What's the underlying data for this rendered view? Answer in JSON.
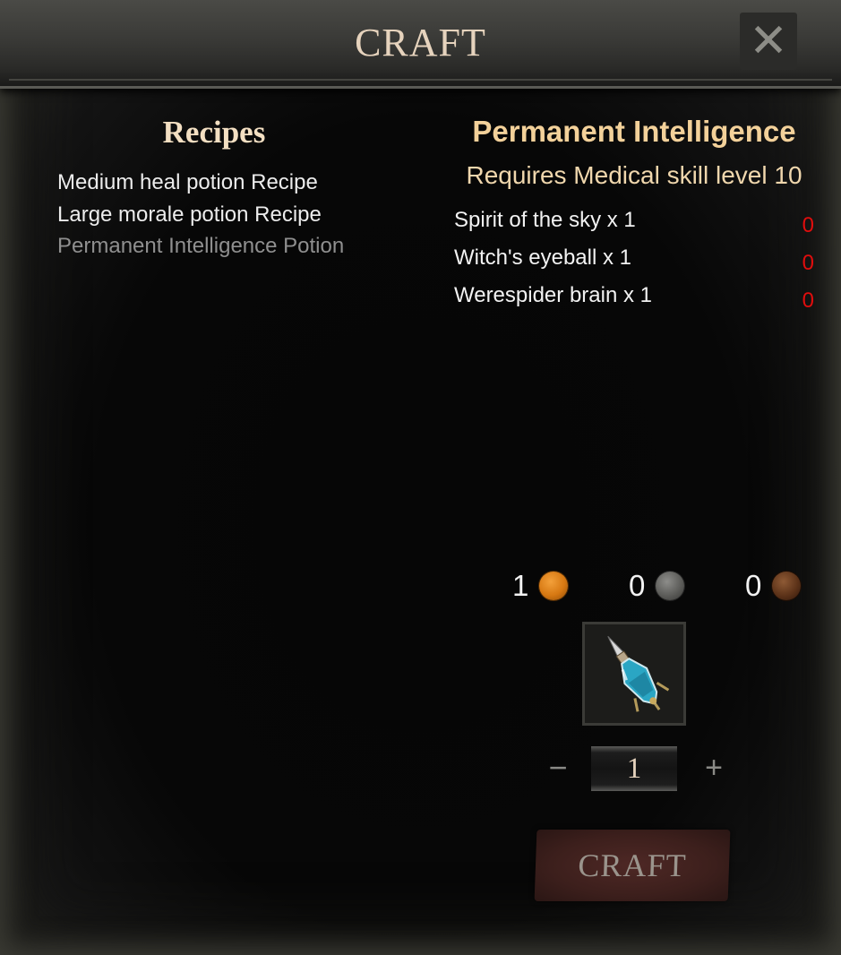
{
  "window": {
    "title": "CRAFT",
    "close_icon": "close-icon"
  },
  "recipes": {
    "heading": "Recipes",
    "items": [
      {
        "label": "Medium heal potion Recipe",
        "selected": false
      },
      {
        "label": "Large morale potion Recipe",
        "selected": false
      },
      {
        "label": "Permanent Intelligence Potion",
        "selected": true
      }
    ]
  },
  "detail": {
    "title": "Permanent Intelligence",
    "requirement": "Requires Medical skill level 10",
    "ingredients": [
      {
        "name": "Spirit of the sky x 1",
        "owned": "0"
      },
      {
        "name": "Witch's eyeball x 1",
        "owned": "0"
      },
      {
        "name": "Werespider brain x 1",
        "owned": "0"
      }
    ]
  },
  "currency": {
    "gold": "1",
    "silver": "0",
    "copper": "0"
  },
  "result_item": {
    "icon": "potion-bottle-icon"
  },
  "quantity": {
    "minus": "−",
    "value": "1",
    "plus": "+"
  },
  "craft_button": {
    "label": "CRAFT"
  },
  "colors": {
    "title_text": "#e6d3bd",
    "heading_text": "#f3d19a",
    "missing_count": "#e00d0d",
    "craft_button_bg": "#4e2825"
  }
}
